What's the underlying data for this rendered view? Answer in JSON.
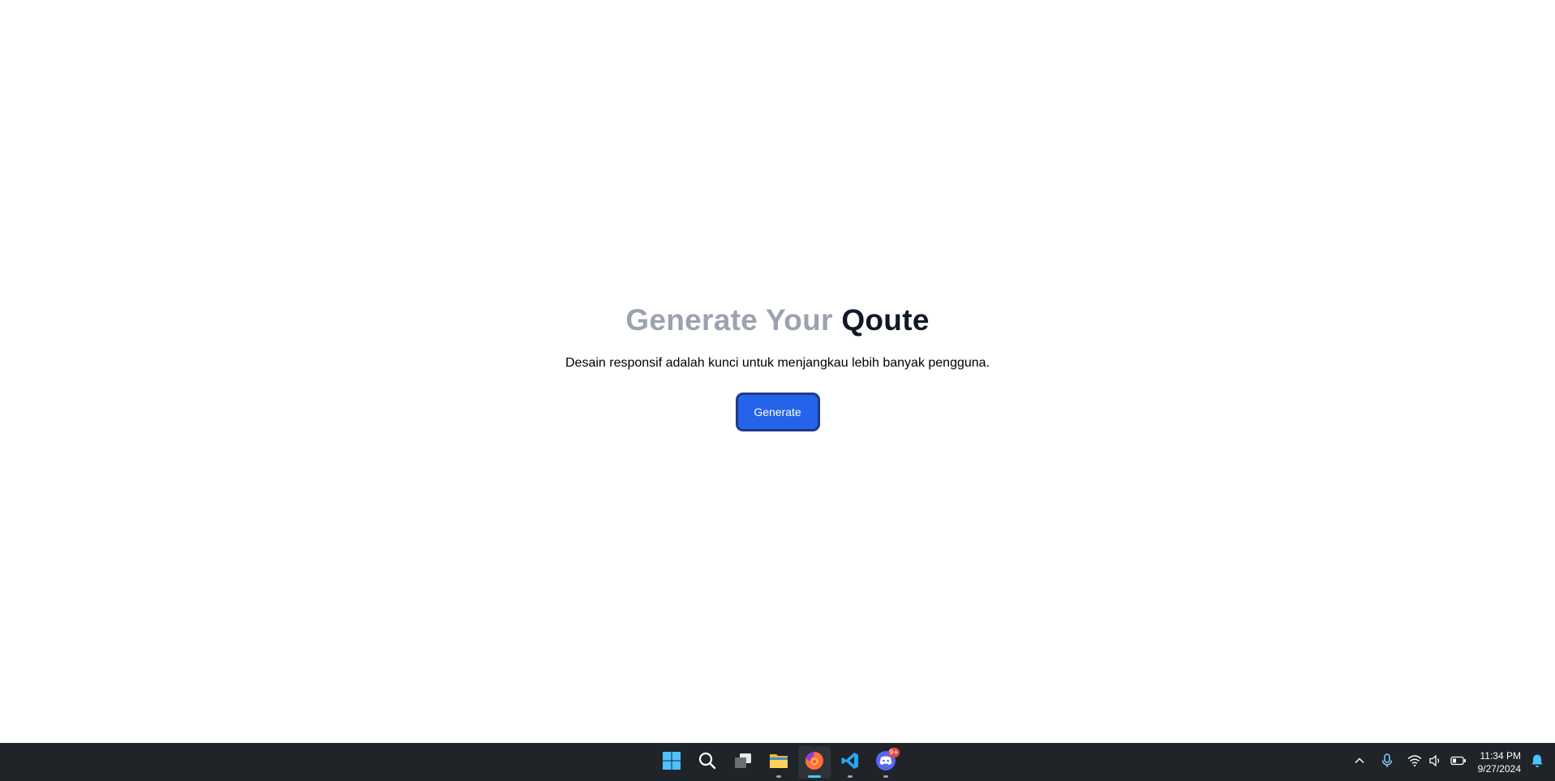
{
  "main": {
    "title_part1": "Generate Your",
    "title_part2": "Qoute",
    "quote_text": "Desain responsif adalah kunci untuk menjangkau lebih banyak pengguna.",
    "generate_label": "Generate"
  },
  "taskbar": {
    "apps": [
      {
        "name": "start-icon"
      },
      {
        "name": "search-icon"
      },
      {
        "name": "task-view-icon"
      },
      {
        "name": "file-explorer-icon"
      },
      {
        "name": "firefox-icon",
        "active": true
      },
      {
        "name": "vscode-icon"
      },
      {
        "name": "discord-icon",
        "badge": "9+"
      }
    ],
    "tray": {
      "icons": [
        "chevron-up-icon",
        "microphone-icon",
        "wifi-icon",
        "volume-icon",
        "battery-icon"
      ],
      "time": "11:34 PM",
      "date": "9/27/2024"
    }
  },
  "colors": {
    "title_muted": "#9ca3af",
    "title_strong": "#111827",
    "button_bg": "#2563eb",
    "button_border": "#1e3a8a",
    "taskbar_bg": "#202327",
    "active_indicator": "#4cc2ff"
  }
}
